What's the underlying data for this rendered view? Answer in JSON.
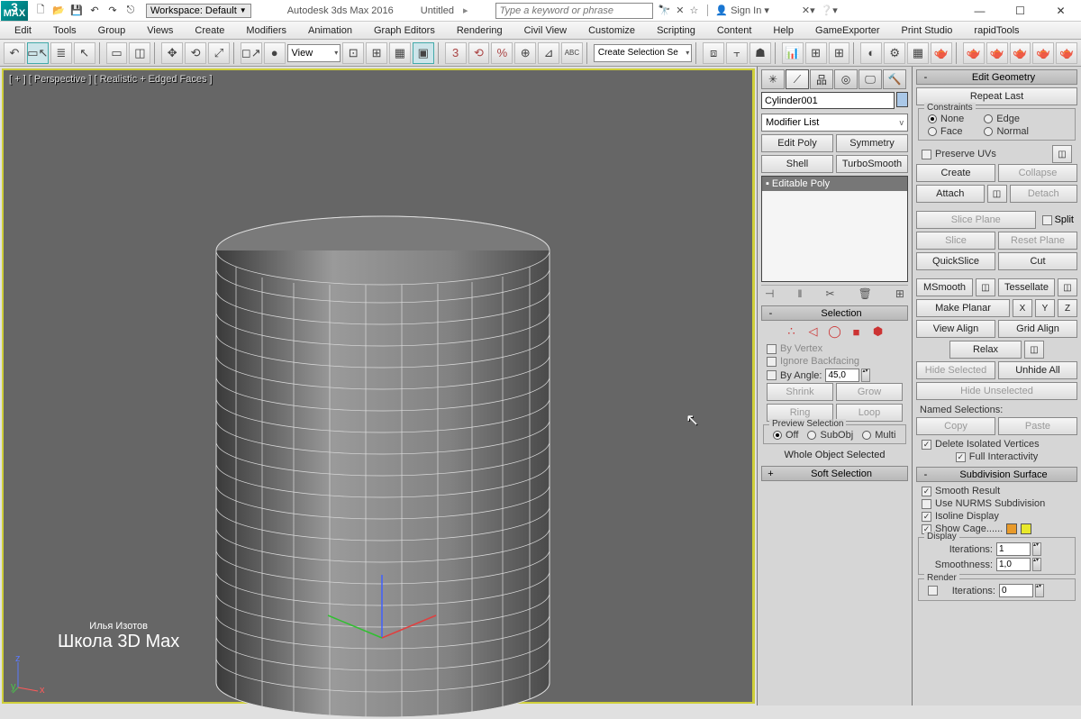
{
  "titlebar": {
    "workspace": "Workspace: Default",
    "app": "Autodesk 3ds Max 2016",
    "doc": "Untitled",
    "search_ph": "Type a keyword or phrase",
    "signin": "Sign In"
  },
  "menu": [
    "Edit",
    "Tools",
    "Group",
    "Views",
    "Create",
    "Modifiers",
    "Animation",
    "Graph Editors",
    "Rendering",
    "Civil View",
    "Customize",
    "Scripting",
    "Content",
    "Help",
    "GameExporter",
    "Print Studio",
    "rapidTools"
  ],
  "toolbar": {
    "viewcombo": "View",
    "selsetcombo": "Create Selection Se"
  },
  "viewport": {
    "label": "[ + ] [ Perspective ] [ Realistic + Edged Faces ]",
    "watermark1": "Илья Изотов",
    "watermark2": "Школа 3D Max"
  },
  "mod": {
    "objname": "Cylinder001",
    "modlist": "Modifier List",
    "btns": [
      "Edit Poly",
      "Symmetry",
      "Shell",
      "TurboSmooth"
    ],
    "stackitem": "Editable Poly",
    "roll_sel": "Selection",
    "byvertex": "By Vertex",
    "ignorebf": "Ignore Backfacing",
    "byangle": "By Angle:",
    "byangle_v": "45,0",
    "shrink": "Shrink",
    "grow": "Grow",
    "ring": "Ring",
    "loop": "Loop",
    "prevsel": "Preview Selection",
    "off": "Off",
    "subo": "SubObj",
    "multi": "Multi",
    "status": "Whole Object Selected",
    "roll_soft": "Soft Selection"
  },
  "edit": {
    "hdr": "Edit Geometry",
    "repeat": "Repeat Last",
    "constraints": "Constraints",
    "none": "None",
    "edge": "Edge",
    "face": "Face",
    "normal": "Normal",
    "preserve": "Preserve UVs",
    "create": "Create",
    "collapse": "Collapse",
    "attach": "Attach",
    "detach": "Detach",
    "sliceplane": "Slice Plane",
    "split": "Split",
    "slice": "Slice",
    "resetplane": "Reset Plane",
    "quickslice": "QuickSlice",
    "cut": "Cut",
    "msmooth": "MSmooth",
    "tess": "Tessellate",
    "makeplanar": "Make Planar",
    "x": "X",
    "y": "Y",
    "z": "Z",
    "viewalign": "View Align",
    "gridalign": "Grid Align",
    "relax": "Relax",
    "hidesel": "Hide Selected",
    "unhideall": "Unhide All",
    "hideunsel": "Hide Unselected",
    "namedsel": "Named Selections:",
    "copy": "Copy",
    "paste": "Paste",
    "deliso": "Delete Isolated Vertices",
    "fullint": "Full Interactivity",
    "subsurf": "Subdivision Surface",
    "smoothres": "Smooth Result",
    "usenurms": "Use NURMS Subdivision",
    "isoline": "Isoline Display",
    "showcage": "Show Cage......",
    "display": "Display",
    "iter": "Iterations:",
    "iter_v": "1",
    "smooth": "Smoothness:",
    "smooth_v": "1,0",
    "render": "Render",
    "riter": "Iterations:",
    "riter_v": "0"
  }
}
